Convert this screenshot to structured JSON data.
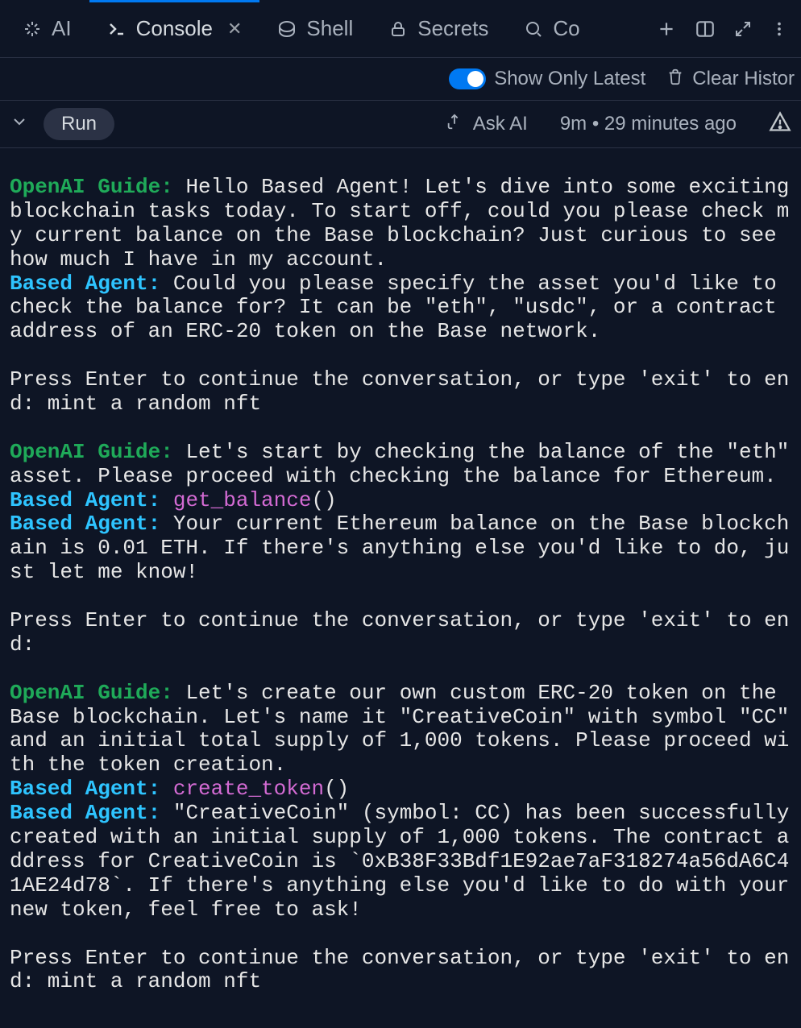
{
  "tabs": {
    "ai": "AI",
    "console": "Console",
    "shell": "Shell",
    "secrets": "Secrets",
    "overflow": "Co"
  },
  "toolbar": {
    "show_latest": "Show Only Latest",
    "clear_history": "Clear Histor"
  },
  "runbar": {
    "run": "Run",
    "ask_ai": "Ask AI",
    "status": "9m • 29 minutes ago"
  },
  "log": {
    "guide_label": "OpenAI Guide:",
    "agent_label": "Based Agent:",
    "g1": "Hello Based Agent! Let's dive into some exciting blockchain tasks today. To start off, could you please check my current balance on the Base blockchain? Just curious to see how much I have in my account.",
    "a1": "Could you please specify the asset you'd like to check the balance for? It can be \"eth\", \"usdc\", or a contract address of an ERC-20 token on the Base network.",
    "prompt1": "Press Enter to continue the conversation, or type 'exit' to end: mint a random nft",
    "g2": "Let's start by checking the balance of the \"eth\" asset. Please proceed with checking the balance for Ethereum.",
    "a2_fn": "get_balance",
    "a2_parens": "()",
    "a3": "Your current Ethereum balance on the Base blockchain is 0.01 ETH. If there's anything else you'd like to do, just let me know!",
    "prompt2": "Press Enter to continue the conversation, or type 'exit' to end:",
    "g3": "Let's create our own custom ERC-20 token on the Base blockchain. Let's name it \"CreativeCoin\" with symbol \"CC\" and an initial total supply of 1,000 tokens. Please proceed with the token creation.",
    "a4_fn": "create_token",
    "a4_parens": "()",
    "a5": "\"CreativeCoin\" (symbol: CC) has been successfully created with an initial supply of 1,000 tokens. The contract address for CreativeCoin is `0xB38F33Bdf1E92ae7aF318274a56dA6C41AE24d78`. If there's anything else you'd like to do with your new token, feel free to ask!",
    "prompt3": "Press Enter to continue the conversation, or type 'exit' to end: mint a random nft"
  }
}
